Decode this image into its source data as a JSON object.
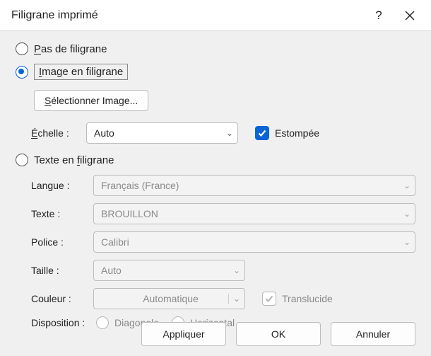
{
  "titlebar": {
    "title": "Filigrane imprimé"
  },
  "options": {
    "no_watermark": {
      "label_pre": "P",
      "label_rest": "as de filigrane"
    },
    "image_watermark": {
      "label_pre": "I",
      "label_rest": "mage en filigrane"
    },
    "text_watermark": {
      "label": "Texte en ",
      "label_u": "f",
      "label_post": "iligrane"
    }
  },
  "image_section": {
    "select_button_pre": "S",
    "select_button_rest": "électionner Image...",
    "scale_label_pre": "É",
    "scale_label_rest": "chelle :",
    "scale_value": "Auto",
    "washout_label": "Estompée"
  },
  "text_section": {
    "language_label": "Langue :",
    "language_value": "Français (France)",
    "text_label": "Texte :",
    "text_value": "BROUILLON",
    "font_label": "Police :",
    "font_value": "Calibri",
    "size_label": "Taille :",
    "size_value": "Auto",
    "color_label": "Couleur :",
    "color_value": "Automatique",
    "translucent_label": "Translucide",
    "layout_label": "Disposition :",
    "layout_diag": "Diagonale",
    "layout_horiz": "Horizontal"
  },
  "footer": {
    "apply": "Appliquer",
    "ok": "OK",
    "cancel": "Annuler"
  }
}
